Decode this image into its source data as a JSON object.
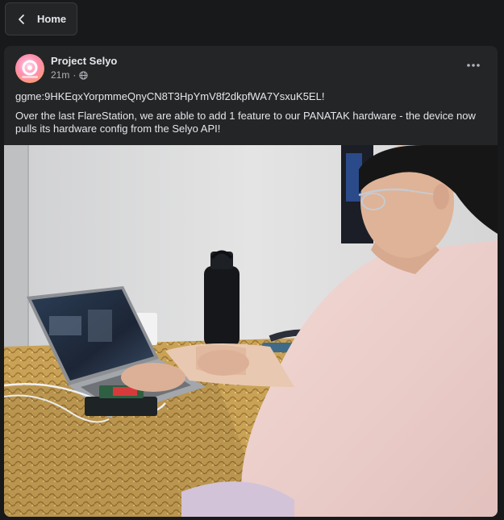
{
  "nav": {
    "back_label": "Home"
  },
  "post": {
    "author": "Project Selyo",
    "time": "21m",
    "separator": "·",
    "visibility_icon": "globe-icon",
    "menu_icon": "more-horizontal-icon",
    "lines": [
      "ggme:9HKEqxYorpmmeQnyCN8T3HpYmV8f2dkpfWA7YsxuK5EL!",
      "Over the last FlareStation, we are able to add 1 feature to our PANATAK hardware - the device now pulls its hardware config from the Selyo API!"
    ]
  },
  "colors": {
    "background": "#18191a",
    "card": "#242526",
    "text": "#e4e6eb",
    "muted": "#b0b3b8"
  }
}
